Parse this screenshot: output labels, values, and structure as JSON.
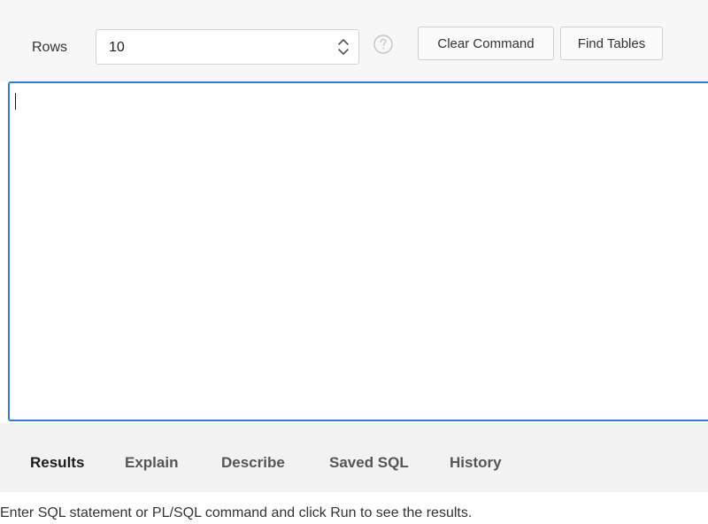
{
  "toolbar": {
    "rows_label": "Rows",
    "rows_value": "10",
    "clear_command_label": "Clear Command",
    "find_tables_label": "Find Tables",
    "icons": {
      "spinner": "up-down-chevron-icon",
      "help": "question-circle-icon"
    }
  },
  "editor": {
    "content": ""
  },
  "tabs": [
    {
      "label": "Results",
      "active": true
    },
    {
      "label": "Explain",
      "active": false
    },
    {
      "label": "Describe",
      "active": false
    },
    {
      "label": "Saved SQL",
      "active": false
    },
    {
      "label": "History",
      "active": false
    }
  ],
  "results": {
    "message": "Enter SQL statement or PL/SQL command and click Run to see the results."
  },
  "colors": {
    "editor_focus_border": "#3a7bd5",
    "toolbar_background": "#f7f7f7",
    "tabs_background": "#f2f2f2"
  }
}
